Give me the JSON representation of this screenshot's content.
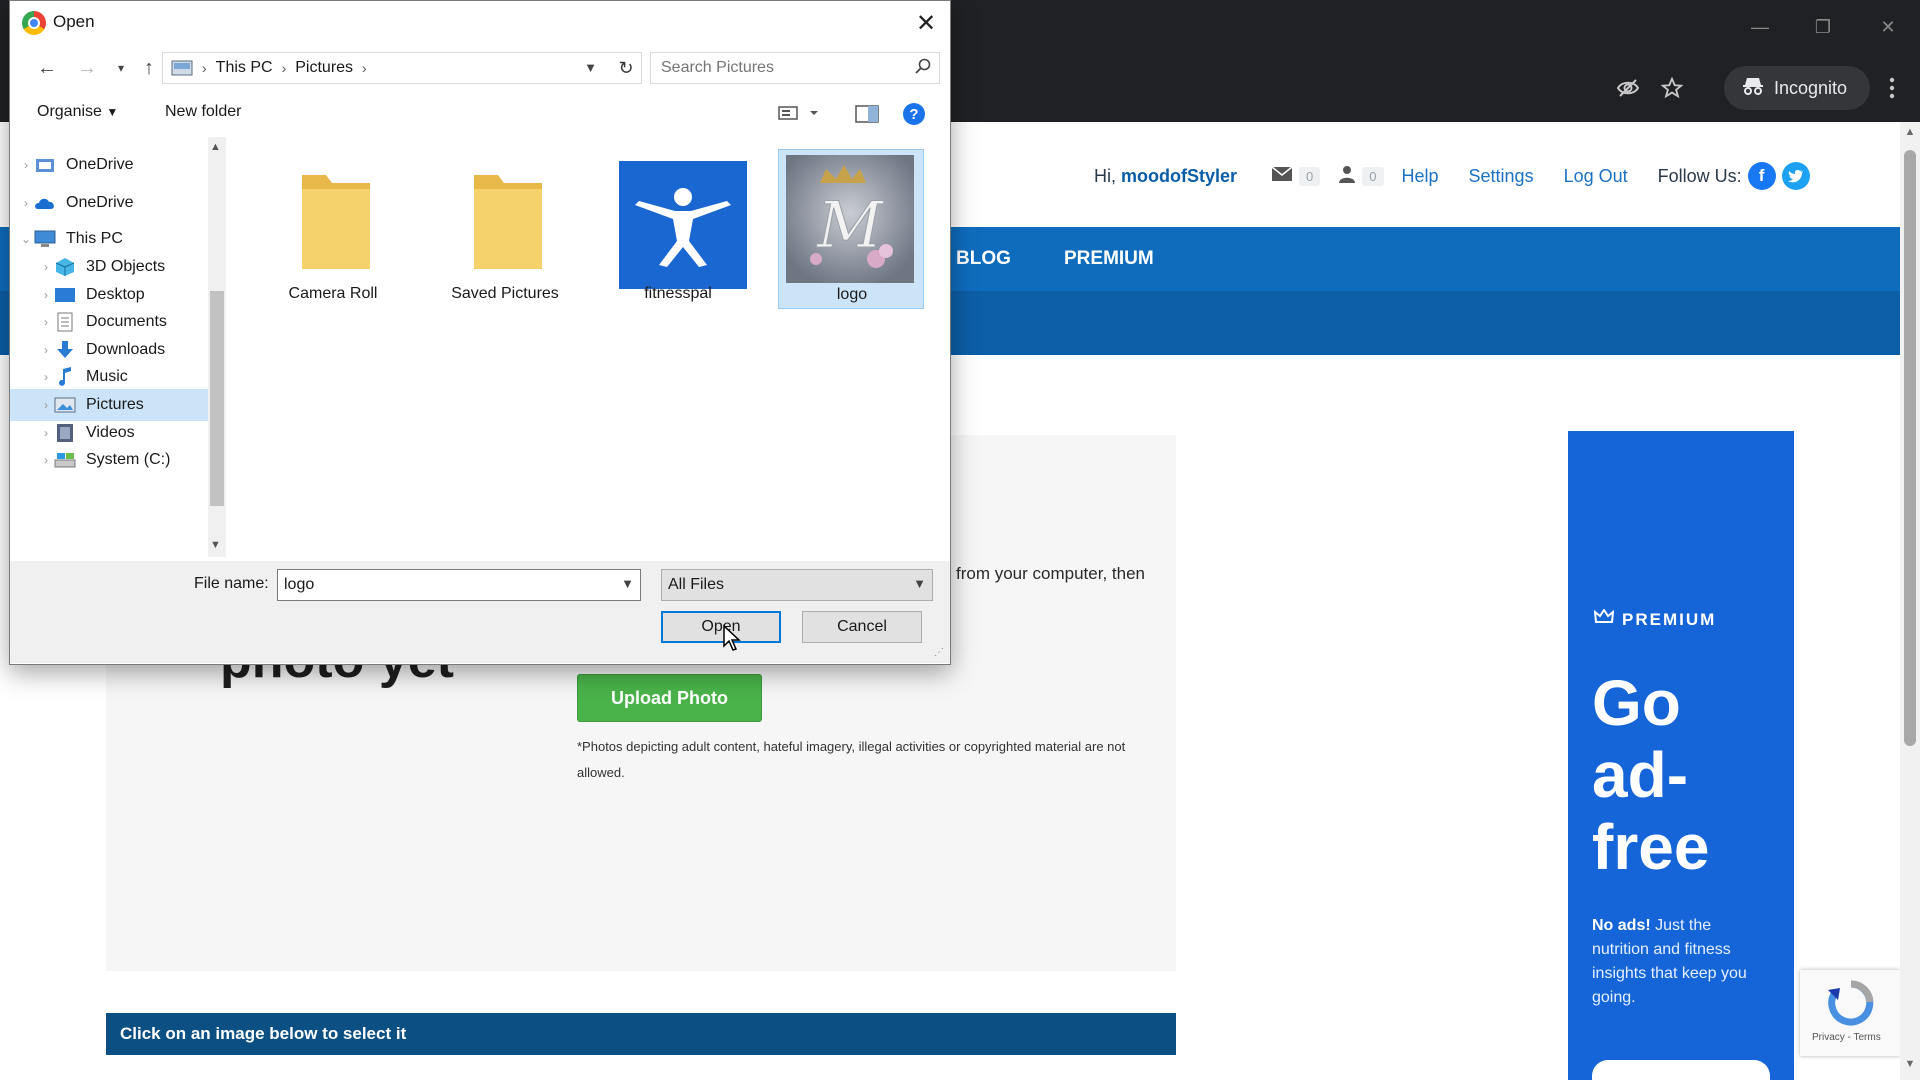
{
  "browser": {
    "incognito_label": "Incognito"
  },
  "site": {
    "greeting": "Hi,",
    "username": "moodofStyler",
    "messages_count": "0",
    "friends_count": "0",
    "links": [
      "Help",
      "Settings",
      "Log Out"
    ],
    "follow_label": "Follow Us:",
    "nav_items": [
      "BLOG",
      "PREMIUM"
    ],
    "no_photo_text": "photo yet",
    "instructions_text": "from your computer, then",
    "upload_button": "Upload Photo",
    "disclaimer": "*Photos depicting adult content, hateful imagery, illegal activities or copyrighted material are not allowed.",
    "select_bar": "Click on an image below to select it",
    "premium_ad": {
      "tag": "PREMIUM",
      "headline": "Go ad-free",
      "body_bold": "No ads!",
      "body_rest": " Just the nutrition and fitness insights that keep you going."
    },
    "recaptcha_text": "Privacy - Terms"
  },
  "dialog": {
    "title": "Open",
    "breadcrumb": [
      "This PC",
      "Pictures"
    ],
    "search_placeholder": "Search Pictures",
    "organise_label": "Organise",
    "new_folder_label": "New folder",
    "nav_tree": [
      {
        "label": "OneDrive",
        "icon": "onedrive-folder-icon"
      },
      {
        "label": "OneDrive",
        "icon": "onedrive-cloud-icon"
      },
      {
        "label": "This PC",
        "icon": "this-pc-icon"
      },
      {
        "label": "3D Objects",
        "icon": "3d-objects-icon"
      },
      {
        "label": "Desktop",
        "icon": "desktop-icon"
      },
      {
        "label": "Documents",
        "icon": "documents-icon"
      },
      {
        "label": "Downloads",
        "icon": "downloads-icon"
      },
      {
        "label": "Music",
        "icon": "music-icon"
      },
      {
        "label": "Pictures",
        "icon": "pictures-icon",
        "selected": true
      },
      {
        "label": "Videos",
        "icon": "videos-icon"
      },
      {
        "label": "System (C:)",
        "icon": "drive-icon"
      }
    ],
    "files": [
      {
        "label": "Camera Roll",
        "type": "folder"
      },
      {
        "label": "Saved Pictures",
        "type": "folder"
      },
      {
        "label": "fitnesspal",
        "type": "image"
      },
      {
        "label": "logo",
        "type": "image",
        "selected": true
      }
    ],
    "file_name_label": "File name:",
    "file_name_value": "logo",
    "file_type": "All Files",
    "open_button": "Open",
    "cancel_button": "Cancel"
  },
  "colors": {
    "site_nav": "#0f6cbd",
    "upload_green": "#4ab34a",
    "premium_blue": "#1565d8",
    "selection": "#cce4f7"
  }
}
